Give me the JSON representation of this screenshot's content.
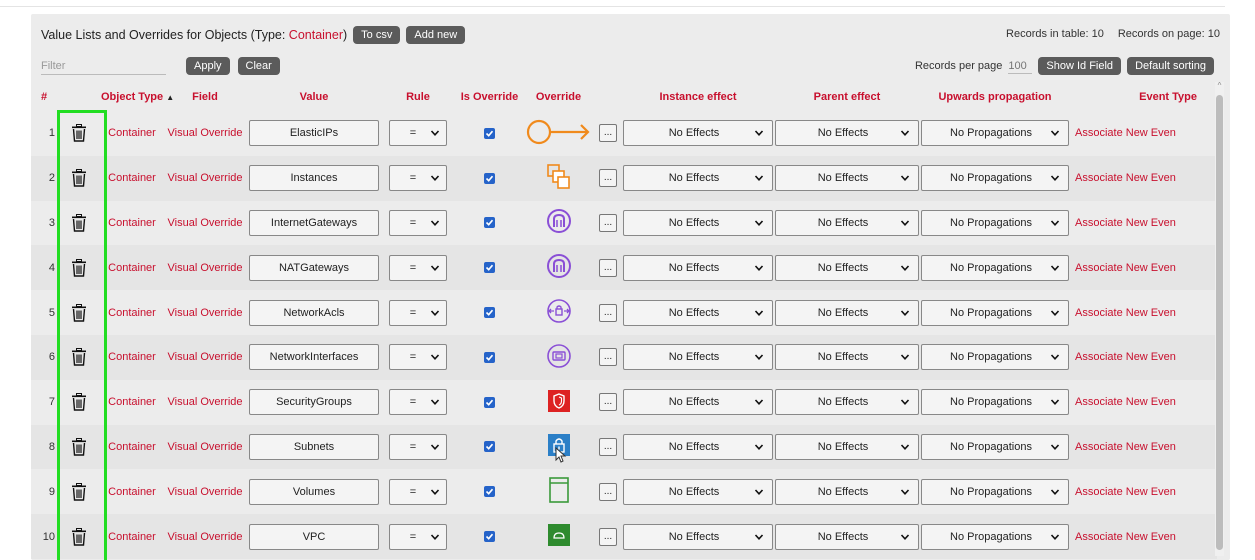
{
  "header": {
    "title_prefix": "Value Lists and Overrides for Objects (Type: ",
    "title_type": "Container",
    "title_suffix": ")",
    "to_csv_label": "To csv",
    "add_new_label": "Add new",
    "records_in_table": "Records in table: 10",
    "records_on_page": "Records on page: 10"
  },
  "filter": {
    "placeholder": "Filter",
    "apply_label": "Apply",
    "clear_label": "Clear"
  },
  "paging": {
    "records_per_page_label": "Records per page",
    "records_per_page_value": "100",
    "show_id_field_label": "Show Id Field",
    "default_sorting_label": "Default sorting"
  },
  "columns": {
    "num": "#",
    "object_type": "Object Type",
    "object_type_sort": "▲",
    "field": "Field",
    "value": "Value",
    "rule": "Rule",
    "is_override": "Is Override",
    "override": "Override",
    "instance_effect": "Instance effect",
    "parent_effect": "Parent effect",
    "upwards_propagation": "Upwards propagation",
    "event_type": "Event Type"
  },
  "rows": [
    {
      "num": "1",
      "object_type": "Container",
      "field": "Visual Override",
      "value": "ElasticIPs",
      "rule": "=",
      "instance_effect": "No Effects",
      "parent_effect": "No Effects",
      "propagation": "No Propagations",
      "event_type": "Associate New Even",
      "icon": "arrow-circle-icon",
      "ellipsis": "..."
    },
    {
      "num": "2",
      "object_type": "Container",
      "field": "Visual Override",
      "value": "Instances",
      "rule": "=",
      "instance_effect": "No Effects",
      "parent_effect": "No Effects",
      "propagation": "No Propagations",
      "event_type": "Associate New Even",
      "icon": "instances-icon",
      "ellipsis": "..."
    },
    {
      "num": "3",
      "object_type": "Container",
      "field": "Visual Override",
      "value": "InternetGateways",
      "rule": "=",
      "instance_effect": "No Effects",
      "parent_effect": "No Effects",
      "propagation": "No Propagations",
      "event_type": "Associate New Even",
      "icon": "gateway-icon",
      "ellipsis": "..."
    },
    {
      "num": "4",
      "object_type": "Container",
      "field": "Visual Override",
      "value": "NATGateways",
      "rule": "=",
      "instance_effect": "No Effects",
      "parent_effect": "No Effects",
      "propagation": "No Propagations",
      "event_type": "Associate New Even",
      "icon": "gateway-icon",
      "ellipsis": "..."
    },
    {
      "num": "5",
      "object_type": "Container",
      "field": "Visual Override",
      "value": "NetworkAcls",
      "rule": "=",
      "instance_effect": "No Effects",
      "parent_effect": "No Effects",
      "propagation": "No Propagations",
      "event_type": "Associate New Even",
      "icon": "network-acl-icon",
      "ellipsis": "..."
    },
    {
      "num": "6",
      "object_type": "Container",
      "field": "Visual Override",
      "value": "NetworkInterfaces",
      "rule": "=",
      "instance_effect": "No Effects",
      "parent_effect": "No Effects",
      "propagation": "No Propagations",
      "event_type": "Associate New Even",
      "icon": "network-interface-icon",
      "ellipsis": "..."
    },
    {
      "num": "7",
      "object_type": "Container",
      "field": "Visual Override",
      "value": "SecurityGroups",
      "rule": "=",
      "instance_effect": "No Effects",
      "parent_effect": "No Effects",
      "propagation": "No Propagations",
      "event_type": "Associate New Even",
      "icon": "shield-icon",
      "ellipsis": "..."
    },
    {
      "num": "8",
      "object_type": "Container",
      "field": "Visual Override",
      "value": "Subnets",
      "rule": "=",
      "instance_effect": "No Effects",
      "parent_effect": "No Effects",
      "propagation": "No Propagations",
      "event_type": "Associate New Even",
      "icon": "lock-icon",
      "ellipsis": "..."
    },
    {
      "num": "9",
      "object_type": "Container",
      "field": "Visual Override",
      "value": "Volumes",
      "rule": "=",
      "instance_effect": "No Effects",
      "parent_effect": "No Effects",
      "propagation": "No Propagations",
      "event_type": "Associate New Even",
      "icon": "volume-icon",
      "ellipsis": "..."
    },
    {
      "num": "10",
      "object_type": "Container",
      "field": "Visual Override",
      "value": "VPC",
      "rule": "=",
      "instance_effect": "No Effects",
      "parent_effect": "No Effects",
      "propagation": "No Propagations",
      "event_type": "Associate New Even",
      "icon": "vpc-icon",
      "ellipsis": "..."
    }
  ],
  "colors": {
    "accent": "#c8102e",
    "button": "#5b5b5b",
    "highlight": "#22dd22",
    "checkbox": "#2563c9"
  }
}
